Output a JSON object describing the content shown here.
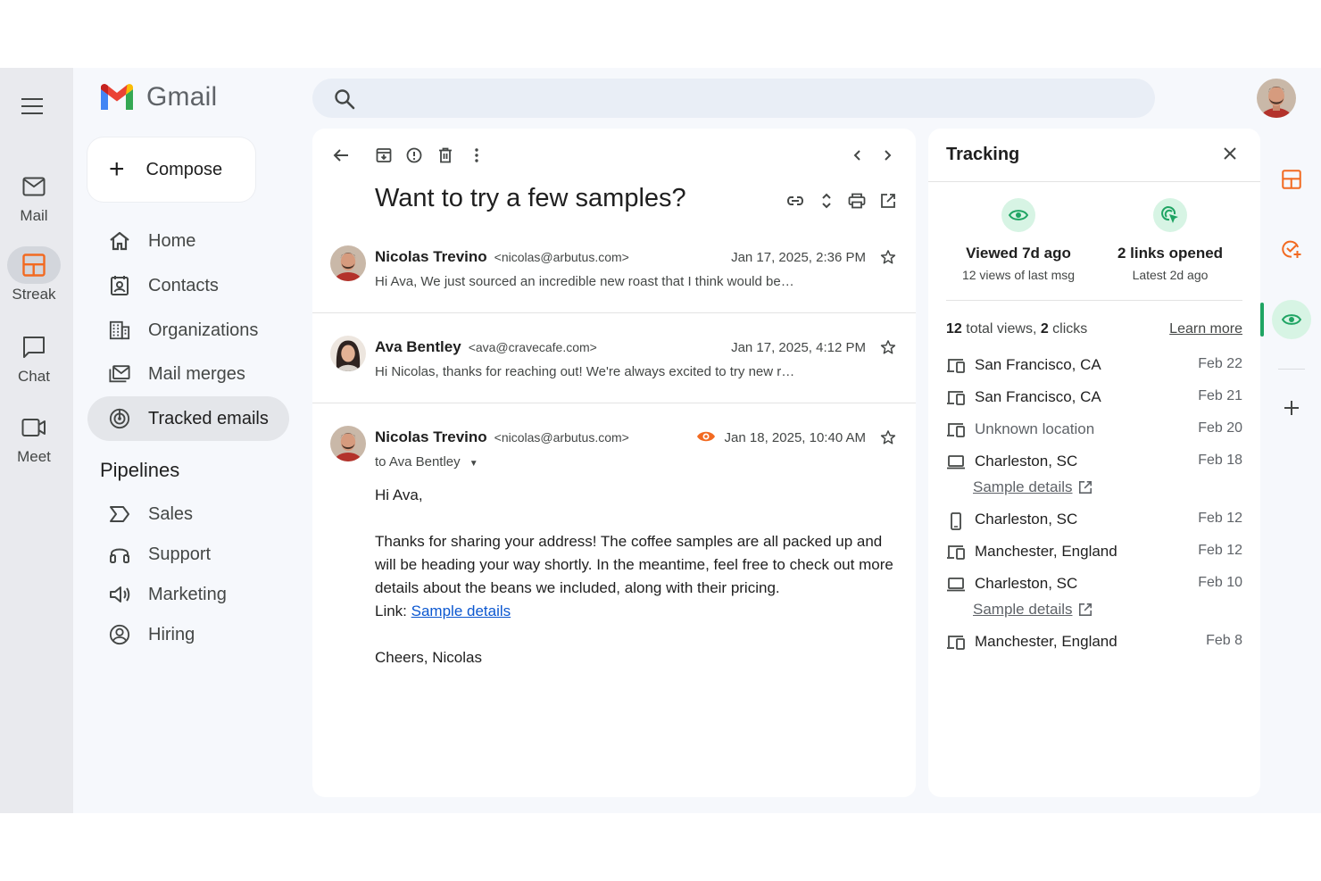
{
  "app": {
    "name": "Gmail"
  },
  "search": {
    "placeholder": ""
  },
  "rail": {
    "items": [
      {
        "label": "Mail",
        "icon": "mail-icon"
      },
      {
        "label": "Streak",
        "icon": "streak-icon"
      },
      {
        "label": "Chat",
        "icon": "chat-icon"
      },
      {
        "label": "Meet",
        "icon": "meet-icon"
      }
    ]
  },
  "sidebar": {
    "compose_label": "Compose",
    "items": [
      {
        "label": "Home",
        "icon": "home-icon"
      },
      {
        "label": "Contacts",
        "icon": "contacts-icon"
      },
      {
        "label": "Organizations",
        "icon": "organizations-icon"
      },
      {
        "label": "Mail merges",
        "icon": "mail-merge-icon"
      },
      {
        "label": "Tracked emails",
        "icon": "tracked-emails-icon",
        "active": true
      }
    ],
    "pipelines_title": "Pipelines",
    "pipelines": [
      {
        "label": "Sales",
        "icon": "sales-icon"
      },
      {
        "label": "Support",
        "icon": "headset-icon"
      },
      {
        "label": "Marketing",
        "icon": "megaphone-icon"
      },
      {
        "label": "Hiring",
        "icon": "person-circle-icon"
      }
    ]
  },
  "thread": {
    "subject": "Want to try a few samples?",
    "messages": [
      {
        "sender": "Nicolas Trevino",
        "email": "<nicolas@arbutus.com>",
        "date": "Jan 17, 2025, 2:36 PM",
        "snippet": "Hi Ava, We just sourced an incredible new roast that I think would be…"
      },
      {
        "sender": "Ava Bentley",
        "email": "<ava@cravecafe.com>",
        "date": "Jan 17, 2025, 4:12 PM",
        "snippet": "Hi Nicolas, thanks for reaching out! We're always excited to try new r…"
      },
      {
        "sender": "Nicolas Trevino",
        "email": "<nicolas@arbutus.com>",
        "date": "Jan 18, 2025, 10:40 AM",
        "to": "to Ava Bentley"
      }
    ],
    "body": {
      "greeting": "Hi Ava,",
      "paragraph": "Thanks for sharing your address! The coffee samples are all packed up and will be heading your way shortly. In the meantime, feel free to check out more details about the beans we included, along with their pricing.",
      "link_prefix": "Link: ",
      "link_text": "Sample details",
      "signoff": "Cheers, Nicolas"
    }
  },
  "tracking": {
    "title": "Tracking",
    "stats": [
      {
        "title": "Viewed 7d ago",
        "sub": "12 views of last msg"
      },
      {
        "title": "2 links opened",
        "sub": "Latest 2d ago"
      }
    ],
    "totals": {
      "views": "12",
      "views_text": " total views, ",
      "clicks": "2",
      "clicks_text": " clicks"
    },
    "learn_more": "Learn more",
    "sample_details": "Sample details",
    "rows": [
      {
        "device": "tablet",
        "location": "San Francisco, CA",
        "date": "Feb 22"
      },
      {
        "device": "tablet",
        "location": "San Francisco, CA",
        "date": "Feb 21"
      },
      {
        "device": "tablet",
        "location": "Unknown location",
        "date": "Feb 20"
      },
      {
        "device": "laptop",
        "location": "Charleston, SC",
        "date": "Feb 18"
      },
      {
        "device": "phone",
        "location": "Charleston, SC",
        "date": "Feb 12"
      },
      {
        "device": "tablet",
        "location": "Manchester, England",
        "date": "Feb 12"
      },
      {
        "device": "laptop",
        "location": "Charleston, SC",
        "date": "Feb 10"
      },
      {
        "device": "tablet",
        "location": "Manchester, England",
        "date": "Feb 8"
      }
    ]
  },
  "colors": {
    "accent_green": "#1fa463",
    "streak_orange": "#f26a21",
    "link_blue": "#0b57d0"
  }
}
